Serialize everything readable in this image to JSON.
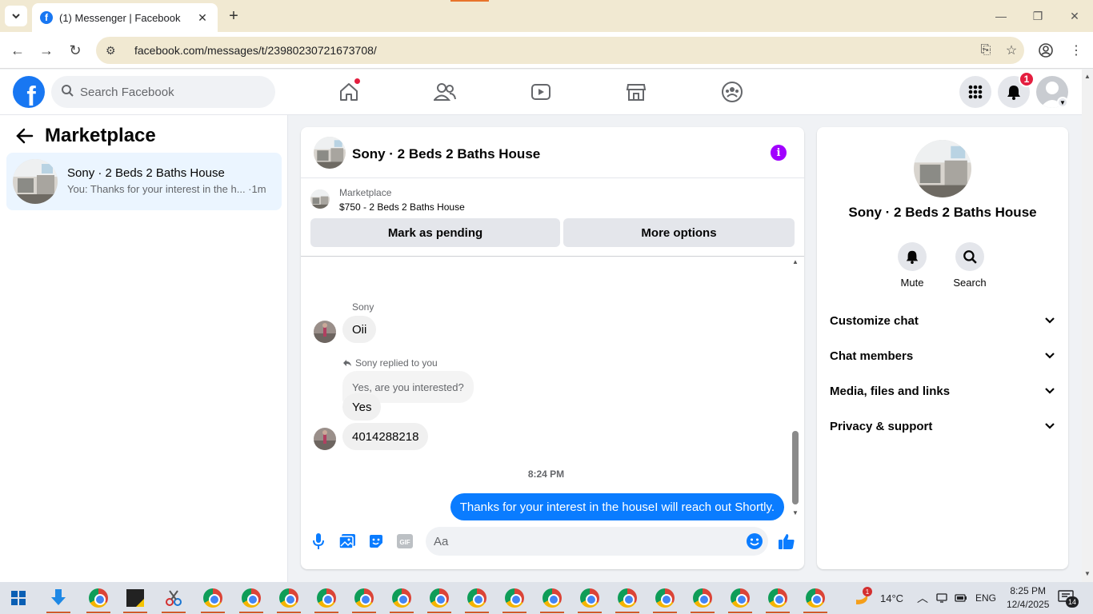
{
  "browser": {
    "tab_title": "(1) Messenger | Facebook",
    "url": "facebook.com/messages/t/23980230721673708/"
  },
  "fb_nav": {
    "search_placeholder": "Search Facebook",
    "notification_count": "1"
  },
  "left": {
    "title": "Marketplace",
    "conversations": [
      {
        "name": "Sony · 2 Beds 2 Baths House",
        "preview": "You: Thanks for your interest in the h... ·1m"
      }
    ]
  },
  "chat": {
    "title": "Sony · 2 Beds 2 Baths House",
    "listing": {
      "kicker": "Marketplace",
      "price_line": "$750 - 2 Beds 2 Baths House",
      "mark_pending_label": "Mark as pending",
      "more_options_label": "More options"
    },
    "messages": {
      "sender": "Sony",
      "msg1": "Oii",
      "reply_label": "Sony replied to you",
      "quoted": "Yes, are you interested?",
      "msg2": "Yes",
      "msg3": "4014288218",
      "time": "8:24 PM",
      "my_msg": "Thanks for your interest in the houseI will reach out Shortly."
    },
    "composer_placeholder": "Aa"
  },
  "right": {
    "title": "Sony · 2 Beds 2 Baths House",
    "actions": [
      "Mute",
      "Search"
    ],
    "sections": [
      "Customize chat",
      "Chat members",
      "Media, files and links",
      "Privacy & support"
    ]
  },
  "taskbar": {
    "weather": "14°C",
    "lang": "ENG",
    "time": "8:25 PM",
    "date": "12/4/2025",
    "notif_count": "14",
    "weather_badge": "1"
  },
  "colors": {
    "facebook_blue": "#1877f2",
    "message_blue": "#0a7cff",
    "info_purple": "#a100ff",
    "selected_conversation": "#ebf5ff"
  }
}
